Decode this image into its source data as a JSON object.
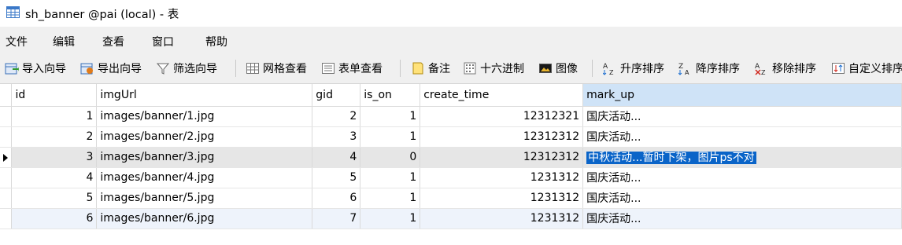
{
  "window": {
    "title": "sh_banner @pai (local) - 表"
  },
  "menu": [
    "文件",
    "编辑",
    "查看",
    "窗口",
    "帮助"
  ],
  "toolbar": {
    "import_wizard": "导入向导",
    "export_wizard": "导出向导",
    "filter_wizard": "筛选向导",
    "grid_view": "网格查看",
    "form_view": "表单查看",
    "memo": "备注",
    "hex": "十六进制",
    "image": "图像",
    "sort_asc": "升序排序",
    "sort_desc": "降序排序",
    "remove_sort": "移除排序",
    "custom_sort": "自定义排序"
  },
  "table": {
    "columns": [
      "id",
      "imgUrl",
      "gid",
      "is_on",
      "create_time",
      "mark_up"
    ],
    "rows": [
      [
        "1",
        "images/banner/1.jpg",
        "2",
        "1",
        "12312321",
        "国庆活动..."
      ],
      [
        "2",
        "images/banner/2.jpg",
        "3",
        "1",
        "12312312",
        "国庆活动..."
      ],
      [
        "3",
        "images/banner/3.jpg",
        "4",
        "0",
        "12312312",
        "中秋活动...暂时下架，图片ps不对"
      ],
      [
        "4",
        "images/banner/4.jpg",
        "5",
        "1",
        "1231312",
        "国庆活动..."
      ],
      [
        "5",
        "images/banner/5.jpg",
        "6",
        "1",
        "1231312",
        "国庆活动..."
      ],
      [
        "6",
        "images/banner/6.jpg",
        "7",
        "1",
        "1231312",
        "国庆活动..."
      ]
    ]
  },
  "colors": {
    "selection": "#0a64c8",
    "header_selected": "#cfe3f7",
    "current_row": "#e6e6e6"
  }
}
